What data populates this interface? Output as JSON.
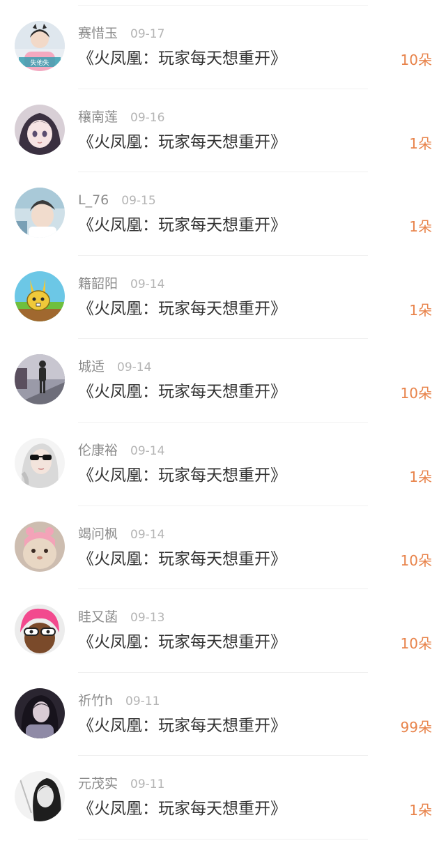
{
  "gift_list": [
    {
      "username": "赛惜玉",
      "date": "09-17",
      "title": "《火凤凰：玩家每天想重开》",
      "amount": "10朵",
      "avatar": "avatar-girl-pink-shirt"
    },
    {
      "username": "穰南莲",
      "date": "09-16",
      "title": "《火凤凰：玩家每天想重开》",
      "amount": "1朵",
      "avatar": "avatar-anime-girl"
    },
    {
      "username": "L_76",
      "date": "09-15",
      "title": "《火凤凰：玩家每天想重开》",
      "amount": "1朵",
      "avatar": "avatar-boy-photo"
    },
    {
      "username": "籍韶阳",
      "date": "09-14",
      "title": "《火凤凰：玩家每天想重开》",
      "amount": "1朵",
      "avatar": "avatar-cartoon-rabbit"
    },
    {
      "username": "城适",
      "date": "09-14",
      "title": "《火凤凰：玩家每天想重开》",
      "amount": "10朵",
      "avatar": "avatar-street-person"
    },
    {
      "username": "伦康裕",
      "date": "09-14",
      "title": "《火凤凰：玩家每天想重开》",
      "amount": "1朵",
      "avatar": "avatar-girl-sunglasses"
    },
    {
      "username": "竭问枫",
      "date": "09-14",
      "title": "《火凤凰：玩家每天想重开》",
      "amount": "10朵",
      "avatar": "avatar-pink-cat"
    },
    {
      "username": "眭又菡",
      "date": "09-13",
      "title": "《火凤凰：玩家每天想重开》",
      "amount": "10朵",
      "avatar": "avatar-pink-hair-cartoon"
    },
    {
      "username": "祈竹h",
      "date": "09-11",
      "title": "《火凤凰：玩家每天想重开》",
      "amount": "99朵",
      "avatar": "avatar-dark-hair-girl"
    },
    {
      "username": "元茂实",
      "date": "09-11",
      "title": "《火凤凰：玩家每天想重开》",
      "amount": "1朵",
      "avatar": "avatar-grayscale-girl"
    }
  ]
}
